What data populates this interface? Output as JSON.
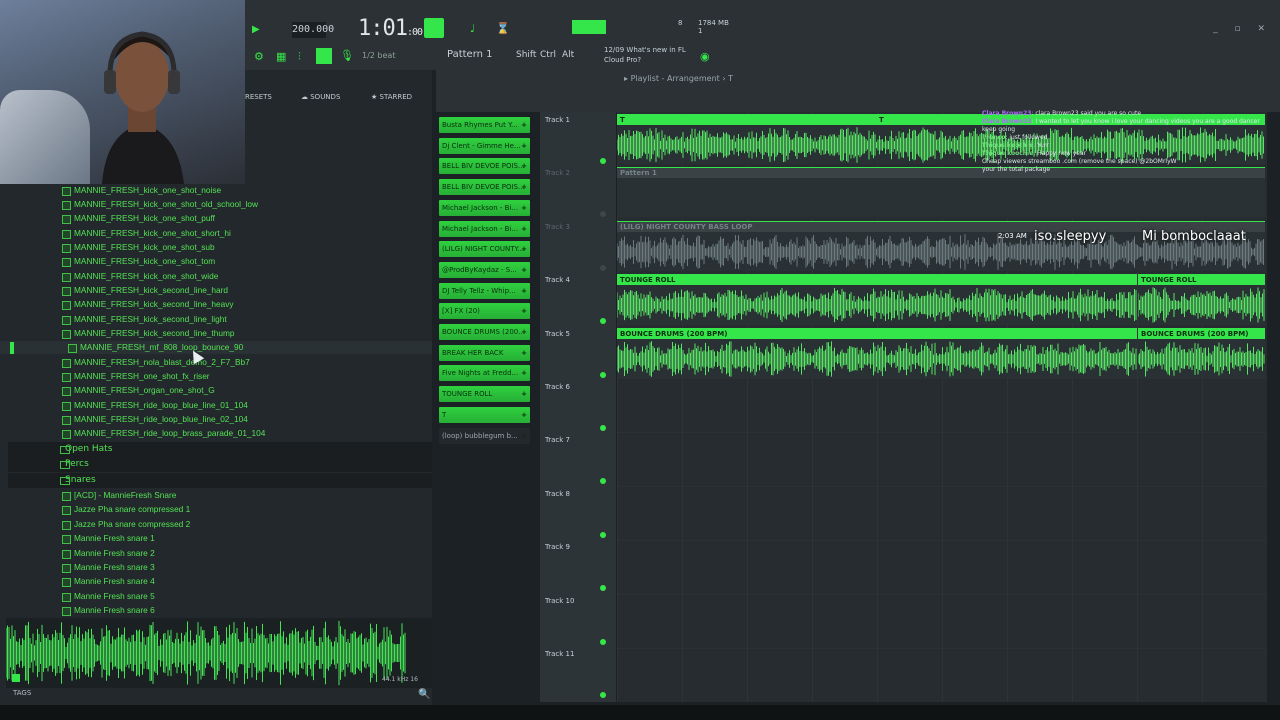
{
  "toolbar": {
    "tempo": "200.000",
    "time": "1:01",
    "time_sub": ":00",
    "pattern": "Pattern 1",
    "snap": "1/2 beat",
    "keys": [
      "Shift",
      "Ctrl",
      "Alt"
    ],
    "news_line1": "12/09  What's new in FL",
    "news_line2": "Cloud Pro?",
    "cpu_count": "8",
    "mem": "1784 MB",
    "cpu_value": "1"
  },
  "browser": {
    "tabs": [
      "RESETS",
      "SOUNDS",
      "STARRED"
    ],
    "items": [
      "MANNIE_FRESH_kick_one_shot_noise",
      "MANNIE_FRESH_kick_one_shot_old_school_low",
      "MANNIE_FRESH_kick_one_shot_puff",
      "MANNIE_FRESH_kick_one_shot_short_hi",
      "MANNIE_FRESH_kick_one_shot_sub",
      "MANNIE_FRESH_kick_one_shot_tom",
      "MANNIE_FRESH_kick_one_shot_wide",
      "MANNIE_FRESH_kick_second_line_hard",
      "MANNIE_FRESH_kick_second_line_heavy",
      "MANNIE_FRESH_kick_second_line_light",
      "MANNIE_FRESH_kick_second_line_thump",
      "MANNIE_FRESH_mf_808_loop_bounce_90",
      "MANNIE_FRESH_nola_blast_demo_2_F7_Bb7",
      "MANNIE_FRESH_one_shot_fx_riser",
      "MANNIE_FRESH_organ_one_shot_G",
      "MANNIE_FRESH_ride_loop_blue_line_01_104",
      "MANNIE_FRESH_ride_loop_blue_line_02_104",
      "MANNIE_FRESH_ride_loop_brass_parade_01_104"
    ],
    "folders": [
      "Open Hats",
      "Percs",
      "Snares"
    ],
    "snares": [
      "[ACD] - MannieFresh Snare",
      "Jazze Pha snare compressed 1",
      "Jazze Pha snare compressed 2",
      "Mannie Fresh snare 1",
      "Mannie Fresh snare 2",
      "Mannie Fresh snare 3",
      "Mannie Fresh snare 4",
      "Mannie Fresh snare 5",
      "Mannie Fresh snare 6"
    ],
    "preview_info": "44.1 kHz 16",
    "tags_label": "TAGS"
  },
  "patterns": [
    "Busta Rhymes Put Y...",
    "Dj Clent - Gimme He...",
    "BELL BIV DEVOE POIS...",
    "BELL BIV DEVOE POIS...",
    "Michael Jackson - Bi...",
    "Michael Jackson - Bi...",
    "(LILG) NIGHT COUNTY...",
    "@ProdByKaydaz - S...",
    "DJ Telly Tellz - Whip...",
    "[X] FX (20)",
    "BOUNCE DRUMS (200...",
    "BREAK HER BACK",
    "Five Nights at Fredd...",
    "TOUNGE ROLL",
    "T",
    "(loop) bubblegum b..."
  ],
  "playlist": {
    "title": "Playlist - Arrangement",
    "title_suffix": "T",
    "tracks": [
      "Track 1",
      "Track 2",
      "Track 3",
      "Track 4",
      "Track 5",
      "Track 6",
      "Track 7",
      "Track 8",
      "Track 9",
      "Track 10",
      "Track 11"
    ],
    "clips": {
      "t1a": "T",
      "t1b": "T",
      "t2": "Pattern 1",
      "t3": "(LILG) NIGHT COUNTY BASS LOOP",
      "t4a": "TOUNGE ROLL",
      "t4b": "TOUNGE ROLL",
      "t5a": "BOUNCE DRUMS (200 BPM)",
      "t5b": "BOUNCE DRUMS (200 BPM)"
    }
  },
  "chat": [
    {
      "user": "Clara Brown23",
      "msg": "clara Brown23 said you are so cute"
    },
    {
      "user": "Clara Brown23",
      "msg": "I wanted to let you know i love your dancing videos you are a good dancer keep going"
    },
    {
      "user": "Prenco",
      "msg": "just followed"
    },
    {
      "user": "Thique koochie",
      "msg": "Yurr"
    },
    {
      "user": "Thique koochie",
      "msg": "Happy new year"
    },
    {
      "user": "",
      "msg": "Cheap viewers streamboo .com (remove the space) @2bOMrlyW"
    },
    {
      "user": "",
      "msg": "your the total package"
    }
  ],
  "stream": {
    "time": "2:03 AM",
    "name": "iso.sleepyy",
    "msg": "Mi bomboclaaat"
  }
}
